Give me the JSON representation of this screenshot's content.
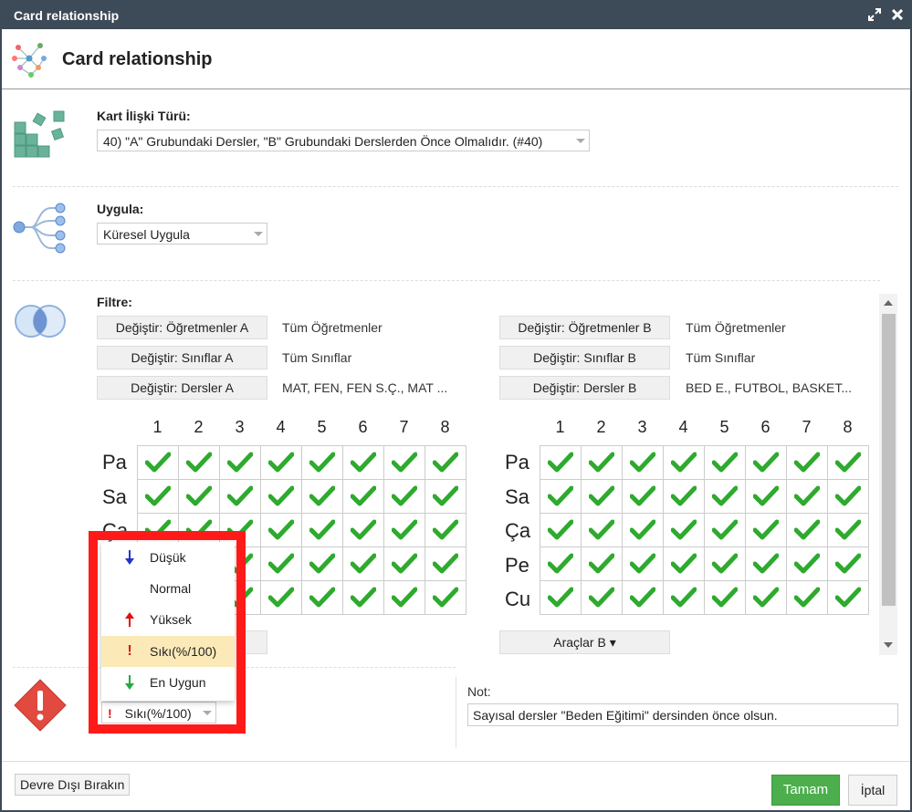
{
  "window": {
    "title": "Card relationship"
  },
  "header": {
    "title": "Card relationship"
  },
  "relation": {
    "label": "Kart İlişki Türü:",
    "value": "40) \"A\" Grubundaki Dersler, \"B\" Grubundaki Derslerden Önce Olmalıdır. (#40)"
  },
  "apply": {
    "label": "Uygula:",
    "value": "Küresel Uygula"
  },
  "filter": {
    "label": "Filtre:",
    "groupA": {
      "teachers_btn": "Değiştir: Öğretmenler A",
      "teachers_val": "Tüm Öğretmenler",
      "classes_btn": "Değiştir: Sınıflar A",
      "classes_val": "Tüm Sınıflar",
      "subjects_btn": "Değiştir: Dersler A",
      "subjects_val": "MAT, FEN, FEN S.Ç., MAT ..."
    },
    "groupB": {
      "teachers_btn": "Değiştir: Öğretmenler B",
      "teachers_val": "Tüm Öğretmenler",
      "classes_btn": "Değiştir: Sınıflar B",
      "classes_val": "Tüm Sınıflar",
      "subjects_btn": "Değiştir: Dersler B",
      "subjects_val": "BED E., FUTBOL, BASKET..."
    }
  },
  "grid": {
    "periods": [
      "1",
      "2",
      "3",
      "4",
      "5",
      "6",
      "7",
      "8"
    ],
    "days": [
      "Pa",
      "Sa",
      "Ça",
      "Pe",
      "Cu"
    ],
    "tools_b": "Araçlar B ▾"
  },
  "importance": {
    "current": "Sıkı(%/100)",
    "options": [
      {
        "label": "Düşük",
        "icon": "arrow-down-blue-icon"
      },
      {
        "label": "Normal",
        "icon": ""
      },
      {
        "label": "Yüksek",
        "icon": "arrow-up-red-icon"
      },
      {
        "label": "Sıkı(%/100)",
        "icon": "exclamation-red-icon",
        "selected": true
      },
      {
        "label": "En Uygun",
        "icon": "arrow-down-green-icon"
      }
    ]
  },
  "note": {
    "label": "Not:",
    "value": "Sayısal dersler \"Beden Eğitimi\" dersinden önce olsun."
  },
  "footer": {
    "disable_label": "Devre Dışı Bırakın",
    "ok_label": "Tamam",
    "cancel_label": "İptal"
  },
  "colors": {
    "titlebar": "#3d4a57",
    "check": "#2eaa2e",
    "ok_button": "#4cae4c",
    "highlight_frame": "#ff1a1a",
    "selected_item": "#fbeab8"
  }
}
